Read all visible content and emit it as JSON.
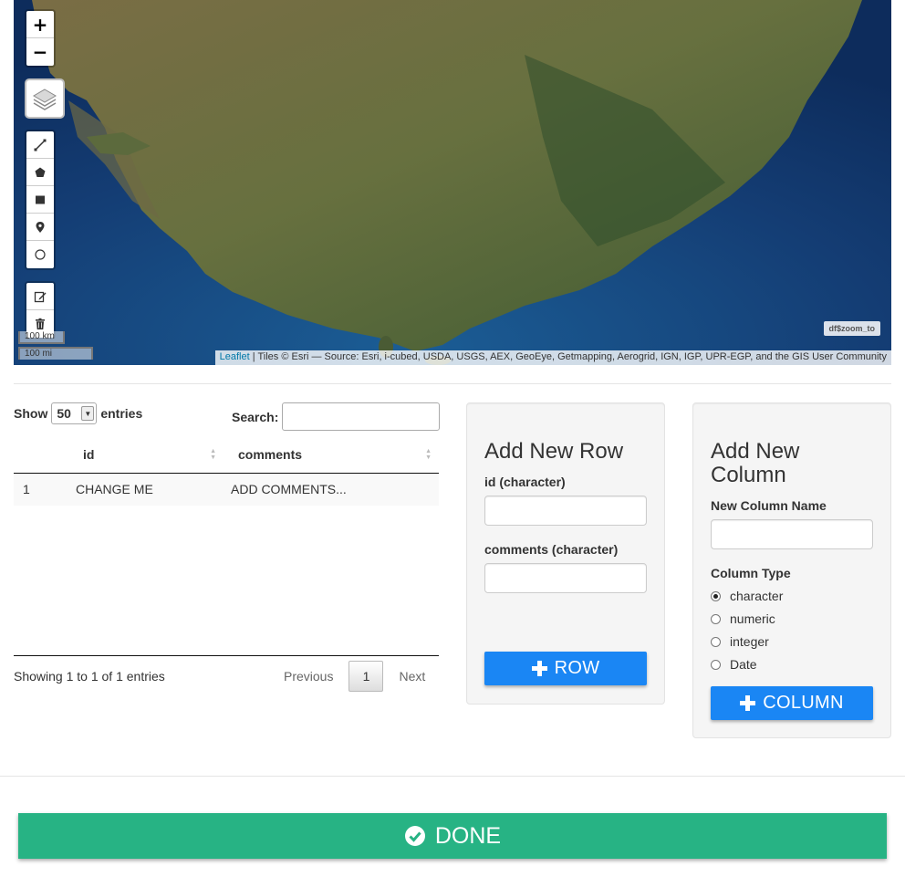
{
  "map": {
    "zoom_in": "+",
    "zoom_out": "−",
    "scale_km": "100 km",
    "scale_mi": "100 mi",
    "attribution_link": "Leaflet",
    "attribution_text": " | Tiles © Esri — Source: Esri, i-cubed, USDA, USGS, AEX, GeoEye, Getmapping, Aerogrid, IGN, IGP, UPR-EGP, and the GIS User Community",
    "zoom_to_label": "df$zoom_to",
    "draw_tools": [
      "polyline-icon",
      "polygon-icon",
      "rectangle-icon",
      "marker-icon",
      "circle-icon"
    ],
    "edit_tools": [
      "edit-icon",
      "trash-icon"
    ]
  },
  "table": {
    "show_label": "Show",
    "length_value": "50",
    "entries_label": "entries",
    "search_label": "Search:",
    "columns": [
      "",
      "id",
      "comments"
    ],
    "rows": [
      {
        "num": "1",
        "id": "CHANGE ME",
        "comments": "ADD COMMENTS..."
      }
    ],
    "info": "Showing 1 to 1 of 1 entries",
    "previous": "Previous",
    "current_page": "1",
    "next": "Next"
  },
  "add_row": {
    "title": "Add New Row",
    "id_label": "id (character)",
    "comments_label": "comments (character)",
    "button_label": "ROW"
  },
  "add_column": {
    "title_line1": "Add New",
    "title_line2": "Column",
    "name_label": "New Column Name",
    "type_label": "Column Type",
    "types": [
      "character",
      "numeric",
      "integer",
      "Date"
    ],
    "selected_type": "character",
    "button_label": "COLUMN"
  },
  "done_label": "DONE",
  "colors": {
    "primary": "#1a86f4",
    "done": "#27b384",
    "ocean": "#10346a",
    "land": "#5d6b3e"
  }
}
